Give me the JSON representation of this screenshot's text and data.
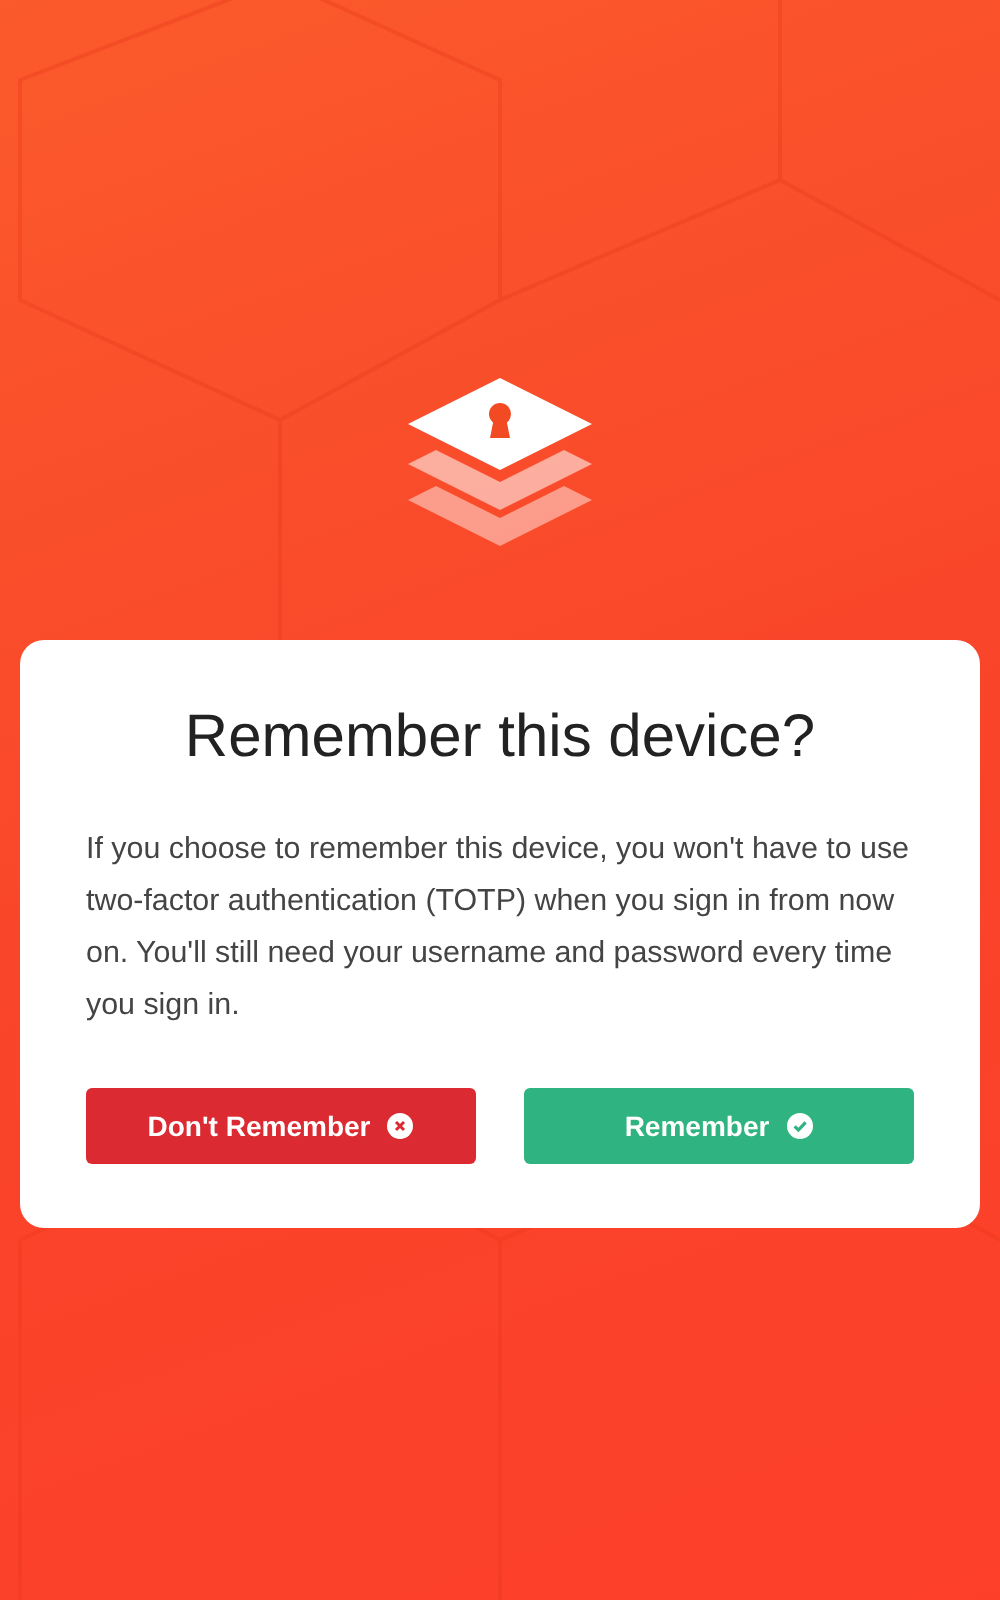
{
  "dialog": {
    "title": "Remember this device?",
    "message": "If you choose to remember this device, you won't have to use two-factor authentication (TOTP) when you sign in from now on. You'll still need your username and password every time you sign in.",
    "buttons": [
      {
        "label": "Don't Remember",
        "kind": "deny"
      },
      {
        "label": "Remember",
        "kind": "confirm"
      }
    ]
  }
}
